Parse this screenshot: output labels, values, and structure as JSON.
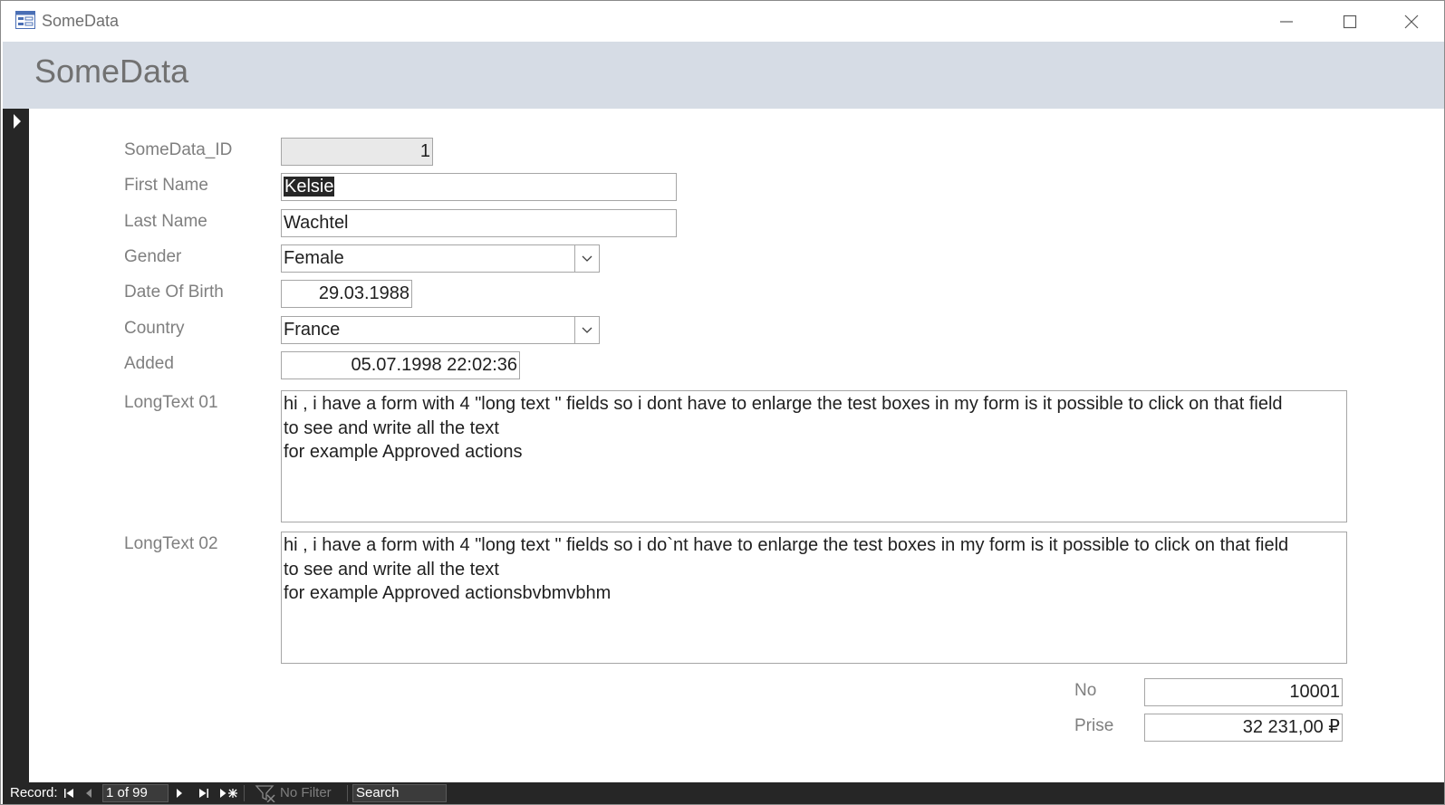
{
  "window": {
    "title": "SomeData",
    "controls": {
      "minimize": "minimize-icon",
      "maximize": "maximize-icon",
      "close": "close-icon"
    }
  },
  "form": {
    "title": "SomeData",
    "fields": {
      "id": {
        "label": "SomeData_ID",
        "value": "1"
      },
      "first_name": {
        "label": "First Name",
        "value": "Kelsie"
      },
      "last_name": {
        "label": "Last Name",
        "value": "Wachtel"
      },
      "gender": {
        "label": "Gender",
        "value": "Female"
      },
      "dob": {
        "label": "Date Of Birth",
        "value": "29.03.1988"
      },
      "country": {
        "label": "Country",
        "value": "France"
      },
      "added": {
        "label": "Added",
        "value": "05.07.1998 22:02:36"
      },
      "longtext01": {
        "label": "LongText 01",
        "value": "hi , i have a form with 4 \"long text \" fields so i dont have to enlarge the test boxes in my form is it possible to click on that field\nto see and write all the text\nfor example Approved actions"
      },
      "longtext02": {
        "label": "LongText 02",
        "value": "hi , i have a form with 4 \"long text \" fields so i do`nt have to enlarge the test boxes in my form is it possible to click on that field\nto see and write all the text\nfor example Approved actionsbvbmvbhm"
      },
      "no": {
        "label": "No",
        "value": "10001"
      },
      "prise": {
        "label": "Prise",
        "value": "32 231,00 ₽"
      }
    }
  },
  "navigation": {
    "record_label": "Record:",
    "record_position": "1 of 99",
    "filter_label": "No Filter",
    "search_placeholder": "Search"
  },
  "colors": {
    "header_bg": "#d6dce5",
    "nav_bg": "#262626",
    "label_text": "#7f7f7f"
  }
}
